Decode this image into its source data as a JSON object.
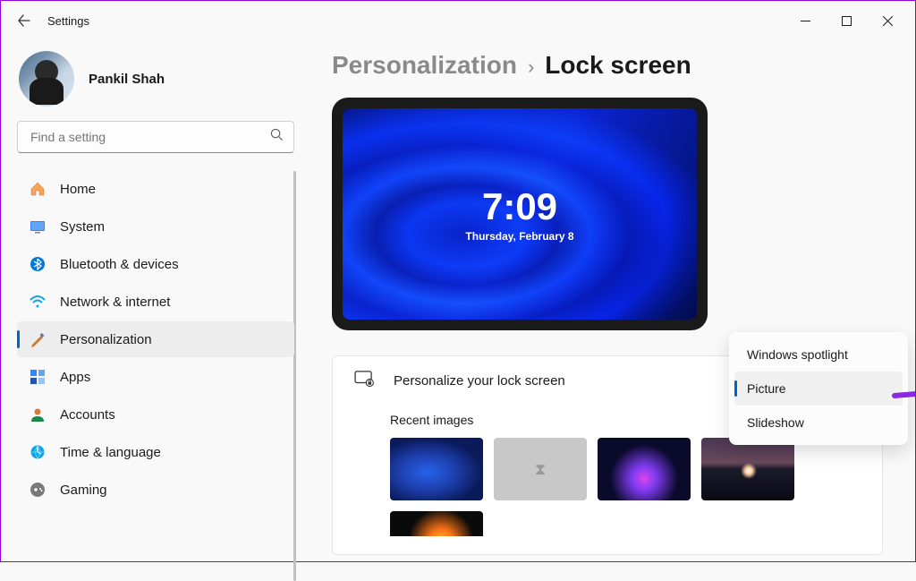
{
  "titlebar": {
    "title": "Settings"
  },
  "user": {
    "name": "Pankil Shah"
  },
  "search": {
    "placeholder": "Find a setting"
  },
  "nav": {
    "items": [
      {
        "label": "Home",
        "icon": "home-icon"
      },
      {
        "label": "System",
        "icon": "system-icon"
      },
      {
        "label": "Bluetooth & devices",
        "icon": "bluetooth-icon"
      },
      {
        "label": "Network & internet",
        "icon": "wifi-icon"
      },
      {
        "label": "Personalization",
        "icon": "personalization-icon",
        "active": true
      },
      {
        "label": "Apps",
        "icon": "apps-icon"
      },
      {
        "label": "Accounts",
        "icon": "accounts-icon"
      },
      {
        "label": "Time & language",
        "icon": "time-language-icon"
      },
      {
        "label": "Gaming",
        "icon": "gaming-icon"
      }
    ]
  },
  "breadcrumb": {
    "parent": "Personalization",
    "current": "Lock screen"
  },
  "preview": {
    "time": "7:09",
    "date": "Thursday, February 8"
  },
  "card": {
    "title": "Personalize your lock screen",
    "recent_label": "Recent images"
  },
  "dropdown": {
    "options": [
      {
        "label": "Windows spotlight"
      },
      {
        "label": "Picture",
        "selected": true
      },
      {
        "label": "Slideshow"
      }
    ]
  }
}
